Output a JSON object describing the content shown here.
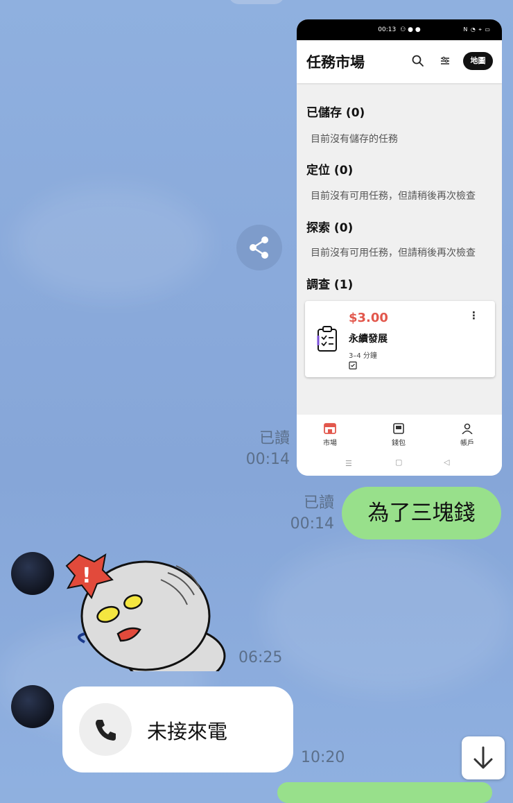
{
  "screenshot": {
    "status_time": "00:13",
    "title": "任務市場",
    "map_button": "地圖",
    "sections": [
      {
        "heading": "已儲存 (0)",
        "text": "目前沒有儲存的任務"
      },
      {
        "heading": "定位 (0)",
        "text": "目前沒有可用任務，但請稍後再次檢查"
      },
      {
        "heading": "探索 (0)",
        "text": "目前沒有可用任務，但請稍後再次檢查"
      },
      {
        "heading": "調查 (1)"
      }
    ],
    "task_card": {
      "price": "$3.00",
      "name": "永續發展",
      "duration": "3–4 分鐘"
    },
    "nav": [
      {
        "label": "市場",
        "icon": "store-icon",
        "active": true
      },
      {
        "label": "錢包",
        "icon": "wallet-icon",
        "active": false
      },
      {
        "label": "帳戶",
        "icon": "person-icon",
        "active": false
      }
    ]
  },
  "chat": {
    "msg1": {
      "status": "已讀",
      "time": "00:14"
    },
    "msg2": {
      "status": "已讀",
      "time": "00:14",
      "text": "為了三塊錢"
    },
    "sticker": {
      "time": "06:25"
    },
    "call": {
      "label": "未接來電",
      "time": "10:20"
    }
  },
  "colors": {
    "green_bubble": "#98e08b",
    "price": "#e2574c",
    "background": "#8aaadb"
  }
}
